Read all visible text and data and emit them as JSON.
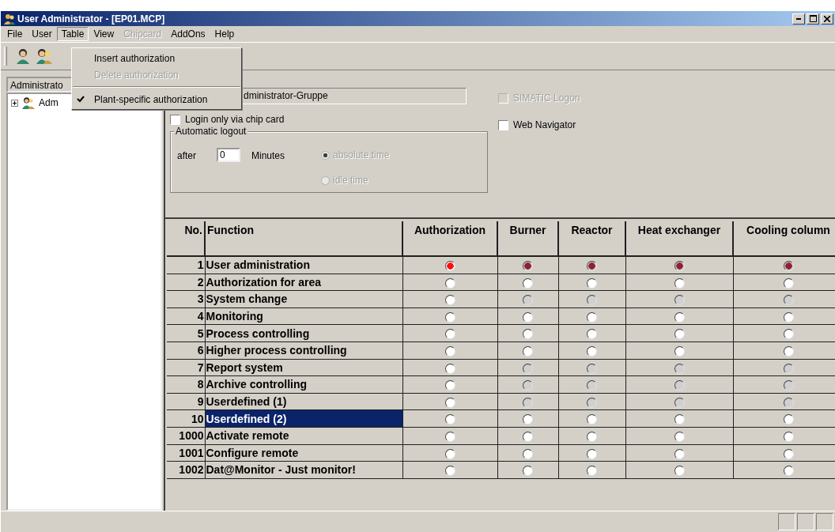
{
  "window": {
    "title": "User Administrator - [EP01.MCP]"
  },
  "menu": [
    {
      "label": "File",
      "open": false,
      "disabled": false
    },
    {
      "label": "User",
      "open": false,
      "disabled": false
    },
    {
      "label": "Table",
      "open": true,
      "disabled": false
    },
    {
      "label": "View",
      "open": false,
      "disabled": false
    },
    {
      "label": "Chipcard",
      "open": false,
      "disabled": true
    },
    {
      "label": "AddOns",
      "open": false,
      "disabled": false
    },
    {
      "label": "Help",
      "open": false,
      "disabled": false
    }
  ],
  "dropdown": [
    {
      "kind": "command",
      "label": "Insert authorization",
      "disabled": false,
      "checked": false
    },
    {
      "kind": "command",
      "label": "Delete authorization",
      "disabled": true,
      "checked": false
    },
    {
      "kind": "separator"
    },
    {
      "kind": "command",
      "label": "Plant-specific authorization",
      "disabled": false,
      "checked": true
    }
  ],
  "sidebar": {
    "combo_value": "Administrato",
    "tree": [
      {
        "label": "Adm",
        "expanded": false
      }
    ]
  },
  "form": {
    "group_name": "dministrator-Gruppe",
    "chip_card": {
      "label": "Login only via chip card",
      "checked": false,
      "disabled": false
    },
    "simatic_logon": {
      "label": "SIMATIC Logon",
      "checked": false,
      "disabled": true
    },
    "web_navigator": {
      "label": "Web Navigator",
      "checked": false,
      "disabled": false
    },
    "automatic_logout": {
      "title": "Automatic logout",
      "after_label": "after",
      "minutes": "0",
      "minutes_label": "Minutes",
      "options": [
        {
          "label": "absolute time",
          "selected": true,
          "disabled": true
        },
        {
          "label": "idle time",
          "selected": false,
          "disabled": true
        }
      ]
    }
  },
  "table": {
    "columns": [
      "No.",
      "Function",
      "Authorization",
      "Burner",
      "Reactor",
      "Heat exchanger",
      "Cooling column"
    ],
    "rows": [
      {
        "no": "1",
        "function": "User administration",
        "selected": false,
        "cells": [
          {
            "selected": true,
            "disabled": false
          },
          {
            "selected": true,
            "disabled": true
          },
          {
            "selected": true,
            "disabled": true
          },
          {
            "selected": true,
            "disabled": true
          },
          {
            "selected": true,
            "disabled": true
          }
        ]
      },
      {
        "no": "2",
        "function": "Authorization for area",
        "selected": false,
        "cells": [
          {
            "selected": false,
            "disabled": false
          },
          {
            "selected": false,
            "disabled": false
          },
          {
            "selected": false,
            "disabled": false
          },
          {
            "selected": false,
            "disabled": false
          },
          {
            "selected": false,
            "disabled": false
          }
        ]
      },
      {
        "no": "3",
        "function": "System change",
        "selected": false,
        "cells": [
          {
            "selected": false,
            "disabled": false
          },
          {
            "selected": false,
            "disabled": true
          },
          {
            "selected": false,
            "disabled": true
          },
          {
            "selected": false,
            "disabled": true
          },
          {
            "selected": false,
            "disabled": true
          }
        ]
      },
      {
        "no": "4",
        "function": "Monitoring",
        "selected": false,
        "cells": [
          {
            "selected": false,
            "disabled": false
          },
          {
            "selected": false,
            "disabled": false
          },
          {
            "selected": false,
            "disabled": false
          },
          {
            "selected": false,
            "disabled": false
          },
          {
            "selected": false,
            "disabled": false
          }
        ]
      },
      {
        "no": "5",
        "function": "Process controlling",
        "selected": false,
        "cells": [
          {
            "selected": false,
            "disabled": false
          },
          {
            "selected": false,
            "disabled": false
          },
          {
            "selected": false,
            "disabled": false
          },
          {
            "selected": false,
            "disabled": false
          },
          {
            "selected": false,
            "disabled": false
          }
        ]
      },
      {
        "no": "6",
        "function": "Higher process controlling",
        "selected": false,
        "cells": [
          {
            "selected": false,
            "disabled": false
          },
          {
            "selected": false,
            "disabled": false
          },
          {
            "selected": false,
            "disabled": false
          },
          {
            "selected": false,
            "disabled": false
          },
          {
            "selected": false,
            "disabled": false
          }
        ]
      },
      {
        "no": "7",
        "function": "Report system",
        "selected": false,
        "cells": [
          {
            "selected": false,
            "disabled": false
          },
          {
            "selected": false,
            "disabled": true
          },
          {
            "selected": false,
            "disabled": true
          },
          {
            "selected": false,
            "disabled": true
          },
          {
            "selected": false,
            "disabled": true
          }
        ]
      },
      {
        "no": "8",
        "function": "Archive controlling",
        "selected": false,
        "cells": [
          {
            "selected": false,
            "disabled": false
          },
          {
            "selected": false,
            "disabled": true
          },
          {
            "selected": false,
            "disabled": true
          },
          {
            "selected": false,
            "disabled": true
          },
          {
            "selected": false,
            "disabled": true
          }
        ]
      },
      {
        "no": "9",
        "function": "Userdefined (1)",
        "selected": false,
        "cells": [
          {
            "selected": false,
            "disabled": false
          },
          {
            "selected": false,
            "disabled": true
          },
          {
            "selected": false,
            "disabled": true
          },
          {
            "selected": false,
            "disabled": true
          },
          {
            "selected": false,
            "disabled": true
          }
        ]
      },
      {
        "no": "10",
        "function": "Userdefined (2)",
        "selected": true,
        "cells": [
          {
            "selected": false,
            "disabled": false
          },
          {
            "selected": false,
            "disabled": false
          },
          {
            "selected": false,
            "disabled": false
          },
          {
            "selected": false,
            "disabled": false
          },
          {
            "selected": false,
            "disabled": false
          }
        ]
      },
      {
        "no": "1000",
        "function": "Activate remote",
        "selected": false,
        "cells": [
          {
            "selected": false,
            "disabled": false
          },
          {
            "selected": false,
            "disabled": false
          },
          {
            "selected": false,
            "disabled": false
          },
          {
            "selected": false,
            "disabled": false
          },
          {
            "selected": false,
            "disabled": false
          }
        ]
      },
      {
        "no": "1001",
        "function": "Configure remote",
        "selected": false,
        "cells": [
          {
            "selected": false,
            "disabled": false
          },
          {
            "selected": false,
            "disabled": false
          },
          {
            "selected": false,
            "disabled": false
          },
          {
            "selected": false,
            "disabled": false
          },
          {
            "selected": false,
            "disabled": false
          }
        ]
      },
      {
        "no": "1002",
        "function": "Dat@Monitor - Just monitor!",
        "selected": false,
        "cells": [
          {
            "selected": false,
            "disabled": false
          },
          {
            "selected": false,
            "disabled": false
          },
          {
            "selected": false,
            "disabled": false
          },
          {
            "selected": false,
            "disabled": false
          },
          {
            "selected": false,
            "disabled": false
          }
        ]
      }
    ]
  }
}
